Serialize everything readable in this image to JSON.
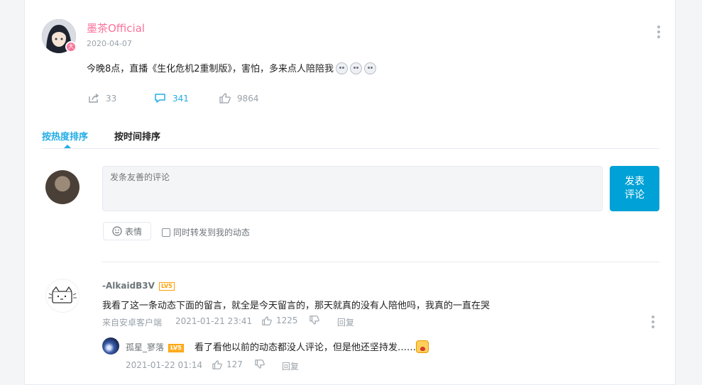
{
  "post": {
    "author_name": "墨茶Official",
    "author_badge": "大",
    "date": "2020-04-07",
    "text": "今晚8点，直播《生化危机2重制版》，害怕，多来点人陪陪我",
    "emoji_count": 3,
    "stats": {
      "share_count": "33",
      "comment_count": "341",
      "like_count": "9864"
    }
  },
  "tabs": [
    {
      "label": "按热度排序",
      "active": true
    },
    {
      "label": "按时间排序",
      "active": false
    }
  ],
  "composer": {
    "placeholder": "发条友善的评论",
    "send_label": "发表\n评论",
    "emoji_label": "表情",
    "repost_label": "同时转发到我的动态"
  },
  "comments": [
    {
      "user": "-AlkaidB3V",
      "level": "LV5",
      "text": "我看了这一条动态下面的留言，就全是今天留言的，那天就真的没有人陪他吗，我真的一直在哭",
      "source": "来自安卓客户端",
      "time": "2021-01-21 23:41",
      "likes": "1225",
      "reply_label": "回复",
      "replies": [
        {
          "user": "孤星_寥落",
          "level": "LV5",
          "text": "看了看他以前的动态都没人评论，但是他还坚持发……",
          "time": "2021-01-22 01:14",
          "likes": "127",
          "reply_label": "回复"
        }
      ]
    }
  ],
  "colors": {
    "accent": "#00a1d6",
    "link_blue": "#23ade5",
    "name_pink": "#fb7299",
    "muted": "#99a2aa",
    "level_orange": "#ff9f00"
  }
}
